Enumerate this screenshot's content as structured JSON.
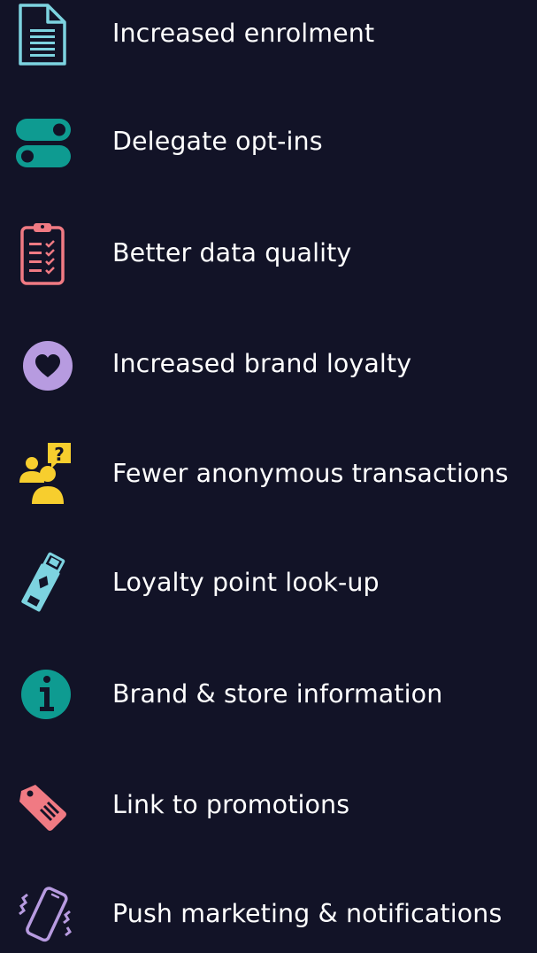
{
  "colors": {
    "background": "#121327",
    "text": "#ffffff",
    "teal": "#0e9b91",
    "light_blue": "#7dd3e0",
    "coral": "#f07a83",
    "lavender": "#b79be0",
    "yellow": "#f7ce2e"
  },
  "benefits": [
    {
      "icon": "document-icon",
      "label": "Increased enrolment"
    },
    {
      "icon": "toggle-switches-icon",
      "label": "Delegate opt-ins"
    },
    {
      "icon": "clipboard-checklist-icon",
      "label": "Better data quality"
    },
    {
      "icon": "heart-circle-icon",
      "label": "Increased brand loyalty"
    },
    {
      "icon": "users-question-icon",
      "label": "Fewer anonymous transactions"
    },
    {
      "icon": "loyalty-card-icon",
      "label": "Loyalty point look-up"
    },
    {
      "icon": "info-circle-icon",
      "label": "Brand & store information"
    },
    {
      "icon": "price-tag-icon",
      "label": "Link to promotions"
    },
    {
      "icon": "vibrating-phone-icon",
      "label": "Push marketing & notifications"
    }
  ]
}
